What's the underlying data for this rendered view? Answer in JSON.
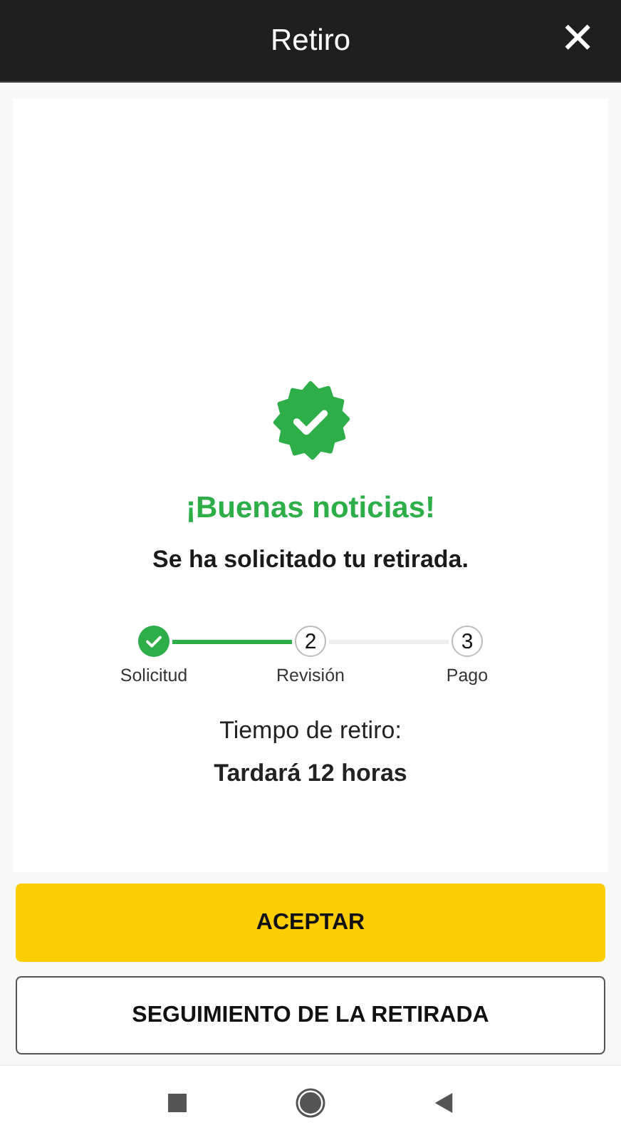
{
  "header": {
    "title": "Retiro",
    "close_icon": "✕"
  },
  "message": {
    "title": "¡Buenas noticias!",
    "subtitle": "Se ha solicitado tu retirada."
  },
  "steps": [
    {
      "label": "Solicitud",
      "completed": true
    },
    {
      "label": "Revisión",
      "number": "2",
      "completed": false
    },
    {
      "label": "Pago",
      "number": "3",
      "completed": false
    }
  ],
  "time": {
    "label": "Tiempo de retiro:",
    "value": "Tardará 12 horas"
  },
  "buttons": [
    {
      "label": "ACEPTAR",
      "kind": "primary"
    },
    {
      "label": "SEGUIMIENTO DE LA RETIRADA",
      "kind": "outline"
    }
  ]
}
